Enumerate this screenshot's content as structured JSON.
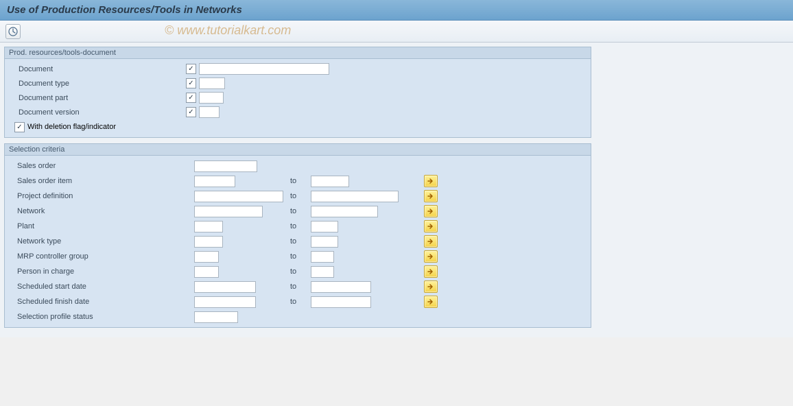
{
  "title": "Use of Production Resources/Tools in Networks",
  "watermark": "© www.tutorialkart.com",
  "toolbar": {
    "execute_title": "Execute"
  },
  "group1": {
    "title": "Prod. resources/tools-document",
    "rows": [
      {
        "label": "Document"
      },
      {
        "label": "Document type"
      },
      {
        "label": "Document part"
      },
      {
        "label": "Document version"
      }
    ],
    "deletion_flag_label": "With deletion flag/indicator"
  },
  "group2": {
    "title": "Selection criteria",
    "to_label": "to",
    "rows": [
      {
        "label": "Sales order",
        "from_w": 92,
        "has_to": false,
        "has_btn": false
      },
      {
        "label": "Sales order item",
        "from_w": 60,
        "has_to": true,
        "to_w": 56,
        "has_btn": true
      },
      {
        "label": "Project definition",
        "from_w": 130,
        "has_to": true,
        "to_w": 128,
        "has_btn": true
      },
      {
        "label": "Network",
        "from_w": 100,
        "has_to": true,
        "to_w": 98,
        "has_btn": true
      },
      {
        "label": "Plant",
        "from_w": 42,
        "has_to": true,
        "to_w": 40,
        "has_btn": true
      },
      {
        "label": "Network type",
        "from_w": 42,
        "has_to": true,
        "to_w": 40,
        "has_btn": true
      },
      {
        "label": "MRP controller group",
        "from_w": 36,
        "has_to": true,
        "to_w": 34,
        "has_btn": true
      },
      {
        "label": "Person in charge",
        "from_w": 36,
        "has_to": true,
        "to_w": 34,
        "has_btn": true
      },
      {
        "label": "Scheduled start date",
        "from_w": 90,
        "has_to": true,
        "to_w": 88,
        "has_btn": true
      },
      {
        "label": "Scheduled finish date",
        "from_w": 90,
        "has_to": true,
        "to_w": 88,
        "has_btn": true
      },
      {
        "label": "Selection profile status",
        "from_w": 64,
        "has_to": false,
        "has_btn": false
      }
    ]
  }
}
